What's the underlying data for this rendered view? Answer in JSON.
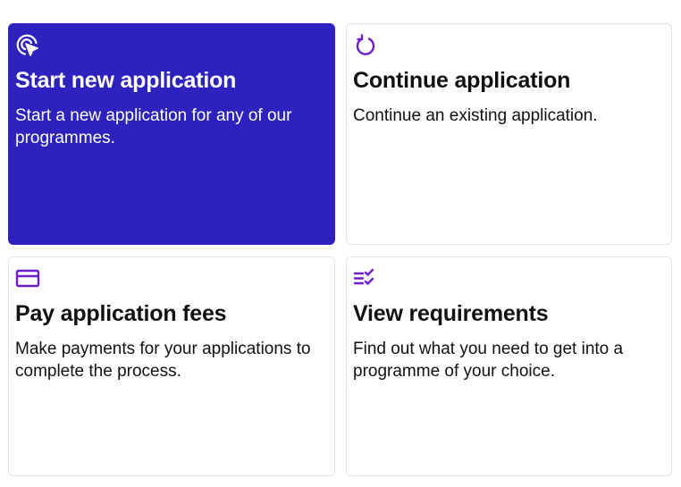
{
  "colors": {
    "accent": "#2e22bf",
    "icon_purple": "#6a1fc9",
    "border": "#e2e2e6"
  },
  "cards": [
    {
      "icon": "cursor-click-icon",
      "title": "Start new application",
      "description": "Start a new application for any of our programmes.",
      "active": true
    },
    {
      "icon": "refresh-icon",
      "title": "Continue application",
      "description": "Continue an existing application.",
      "active": false
    },
    {
      "icon": "credit-card-icon",
      "title": "Pay application fees",
      "description": "Make payments for your applications to complete the process.",
      "active": false
    },
    {
      "icon": "checklist-icon",
      "title": "View requirements",
      "description": "Find out what you need to get into a programme of your choice.",
      "active": false
    }
  ]
}
